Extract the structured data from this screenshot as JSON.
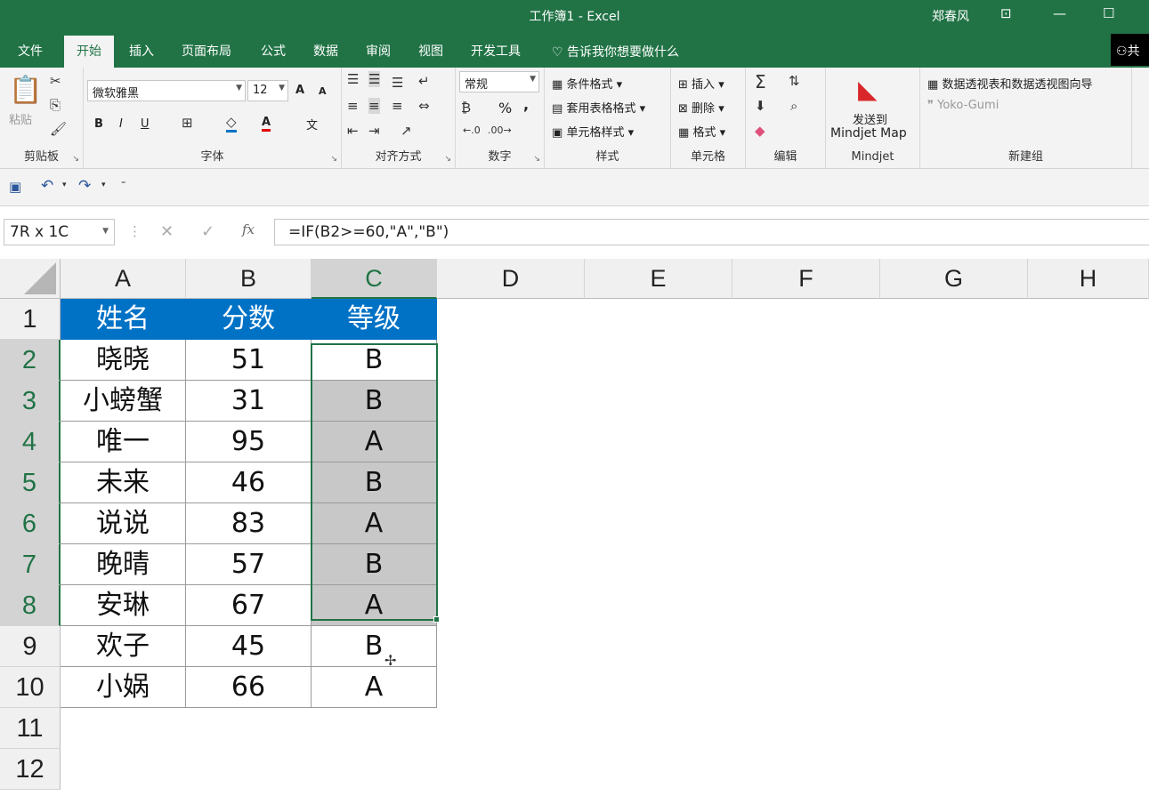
{
  "window": {
    "title": "工作簿1  -  Excel",
    "user": "郑春风"
  },
  "tabs": [
    "文件",
    "开始",
    "插入",
    "页面布局",
    "公式",
    "数据",
    "审阅",
    "视图",
    "开发工具"
  ],
  "tell_me": "告诉我你想要做什么",
  "share_label": "共",
  "ribbon": {
    "clipboard": {
      "label": "剪贴板",
      "paste": "粘贴"
    },
    "font": {
      "label": "字体",
      "name": "微软雅黑",
      "size": "12",
      "bold": "B",
      "italic": "I",
      "underline": "U",
      "grow": "A",
      "shrink": "A",
      "color": "A",
      "phonetic": "文"
    },
    "alignment": {
      "label": "对齐方式"
    },
    "number": {
      "label": "数字",
      "format": "常规",
      "percent": "%",
      "comma": ","
    },
    "styles": {
      "label": "样式",
      "conditional": "条件格式",
      "table": "套用表格格式",
      "cell": "单元格样式"
    },
    "cells": {
      "label": "单元格",
      "insert": "插入",
      "delete": "删除",
      "format": "格式"
    },
    "editing": {
      "label": "编辑"
    },
    "mindjet": {
      "label": "Mindjet",
      "send_line1": "发送到",
      "send_line2": "Mindjet Map"
    },
    "newgroup": {
      "label": "新建组",
      "pivot": "数据透视表和数据透视图向导",
      "yoko": "Yoko-Gumi"
    }
  },
  "formula_bar": {
    "name_box": "7R x 1C",
    "formula": "=IF(B2>=60,\"A\",\"B\")",
    "fx": "fx"
  },
  "columns": [
    "A",
    "B",
    "C",
    "D",
    "E",
    "F",
    "G",
    "H"
  ],
  "rows": [
    "1",
    "2",
    "3",
    "4",
    "5",
    "6",
    "7",
    "8",
    "9",
    "10",
    "11",
    "12"
  ],
  "sheet": {
    "header": [
      "姓名",
      "分数",
      "等级"
    ],
    "data": [
      [
        "晓晓",
        "51",
        "B"
      ],
      [
        "小螃蟹",
        "31",
        "B"
      ],
      [
        "唯一",
        "95",
        "A"
      ],
      [
        "未来",
        "46",
        "B"
      ],
      [
        "说说",
        "83",
        "A"
      ],
      [
        "晚晴",
        "57",
        "B"
      ],
      [
        "安琳",
        "67",
        "A"
      ],
      [
        "欢子",
        "45",
        "B"
      ],
      [
        "小娲",
        "66",
        "A"
      ]
    ]
  },
  "colors": {
    "excel_green": "#217346",
    "header_fill": "#0072c6",
    "selection_shade": "#c8c8c8"
  }
}
